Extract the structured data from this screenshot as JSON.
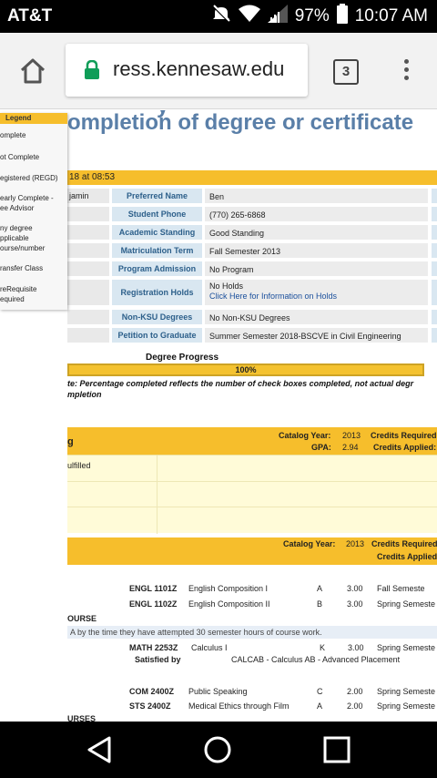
{
  "status_bar": {
    "carrier": "AT&T",
    "battery": "97%",
    "time": "10:07 AM",
    "icons": [
      "mute-icon",
      "wifi-icon",
      "signal-icon",
      "battery-icon"
    ]
  },
  "browser": {
    "url": "ress.kennesaw.edu",
    "tab_count": "3",
    "icons": [
      "home-icon",
      "lock-icon",
      "tabs-icon",
      "more-vert-icon"
    ]
  },
  "page": {
    "heading": "ompletion of degree or certificate",
    "heading_top_cut": "y",
    "timestamp": "18 at 08:53",
    "student_name_fragment": "jamin",
    "info_rows": [
      {
        "label": "Preferred Name",
        "value": "Ben"
      },
      {
        "label": "Student Phone",
        "value": "(770) 265-6868"
      },
      {
        "label": "Academic Standing",
        "value": "Good Standing"
      },
      {
        "label": "Matriculation Term",
        "value": "Fall Semester 2013"
      },
      {
        "label": "Program Admission",
        "value": "No Program"
      },
      {
        "label": "Registration Holds",
        "value": "No Holds",
        "link": "Click Here for Information on Holds"
      },
      {
        "label": "Non-KSU Degrees",
        "value": "No Non-KSU Degrees"
      },
      {
        "label": "Petition to Graduate",
        "value": "Summer Semester 2018-BSCVE in Civil Engineering"
      }
    ],
    "degree_progress": {
      "title": "Degree Progress",
      "percent_text": "100%",
      "percent": 100,
      "note": "te: Percentage completed reflects the number of check boxes completed, not actual degr",
      "note_line2": "mpletion"
    },
    "section1": {
      "left": "g",
      "catalog_year_label": "Catalog Year:",
      "catalog_year": "2013",
      "credits_required_label": "Credits Required:",
      "gpa_label": "GPA:",
      "gpa": "2.94",
      "credits_applied_label": "Credits Applied:",
      "body_text": "ulfilled"
    },
    "section2": {
      "catalog_year_label": "Catalog Year:",
      "catalog_year": "2013",
      "credits_required_label": "Credits Required",
      "credits_applied_label": "Credits Applied"
    },
    "courses": [
      {
        "code": "ENGL 1101Z",
        "title": "English Composition I",
        "grade": "A",
        "credits": "3.00",
        "term": "Fall Semeste"
      },
      {
        "code": "ENGL 1102Z",
        "title": "English Composition II",
        "grade": "B",
        "credits": "3.00",
        "term": "Spring Semeste"
      }
    ],
    "course_label_1": "OURSE",
    "band_text": "A  by the time they have attempted 30 semester  hours of course work.",
    "math_course": {
      "code": "MATH 2253Z",
      "title": "Calculus I",
      "grade": "K",
      "credits": "3.00",
      "term": "Spring Semeste"
    },
    "satisfied_by_label": "Satisfied by",
    "satisfied_by_value": "CALCAB - Calculus AB - Advanced Placement",
    "courses2": [
      {
        "code": "COM 2400Z",
        "title": "Public Speaking",
        "grade": "C",
        "credits": "2.00",
        "term": "Spring Semeste"
      },
      {
        "code": "STS 2400Z",
        "title": "Medical Ethics through Film",
        "grade": "A",
        "credits": "2.00",
        "term": "Spring Semeste"
      }
    ],
    "course_label_2": "URSES"
  },
  "legend": {
    "title": "Legend",
    "items": [
      "omplete",
      "ot Complete",
      "egistered (REGD)",
      "early Complete -",
      "ee Advisor",
      "ny degree",
      "pplicable",
      "ourse/number",
      "ransfer Class",
      "reRequisite",
      "equired"
    ]
  },
  "navbar": {
    "icons": [
      "back-icon",
      "home-circle-icon",
      "recents-icon"
    ]
  }
}
